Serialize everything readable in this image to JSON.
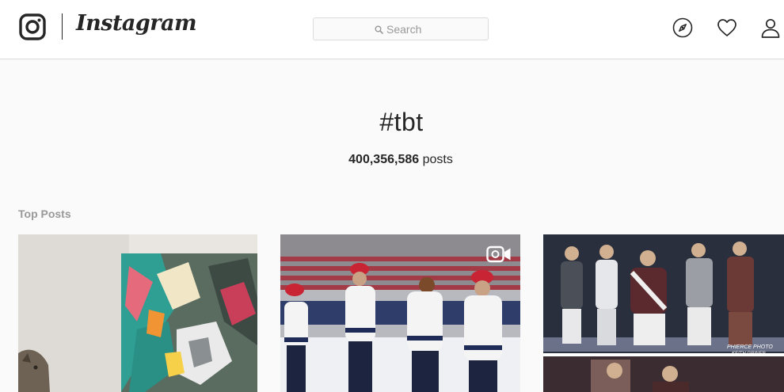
{
  "header": {
    "brand": "Instagram",
    "search": {
      "placeholder": "Search",
      "value": ""
    },
    "icons": [
      "instagram-logo-icon",
      "explore-compass-icon",
      "heart-icon",
      "profile-icon"
    ]
  },
  "hashtag": {
    "title": "#tbt",
    "count": "400,356,586",
    "count_label": "posts"
  },
  "top_posts": {
    "label": "Top Posts",
    "posts": [
      {
        "description": "abstract painting with cat",
        "is_video": false
      },
      {
        "description": "hockey players in santa hats",
        "is_video": true
      },
      {
        "description": "band on stage",
        "is_video": false
      }
    ]
  },
  "overlays": {
    "photo_credit": "PHIERCE PHOTO",
    "photo_credit_2": "KEITH GRINER"
  },
  "colors": {
    "background": "#fafafa",
    "header_bg": "#ffffff",
    "border": "#dbdbdb",
    "text": "#262626",
    "muted": "#999999"
  }
}
